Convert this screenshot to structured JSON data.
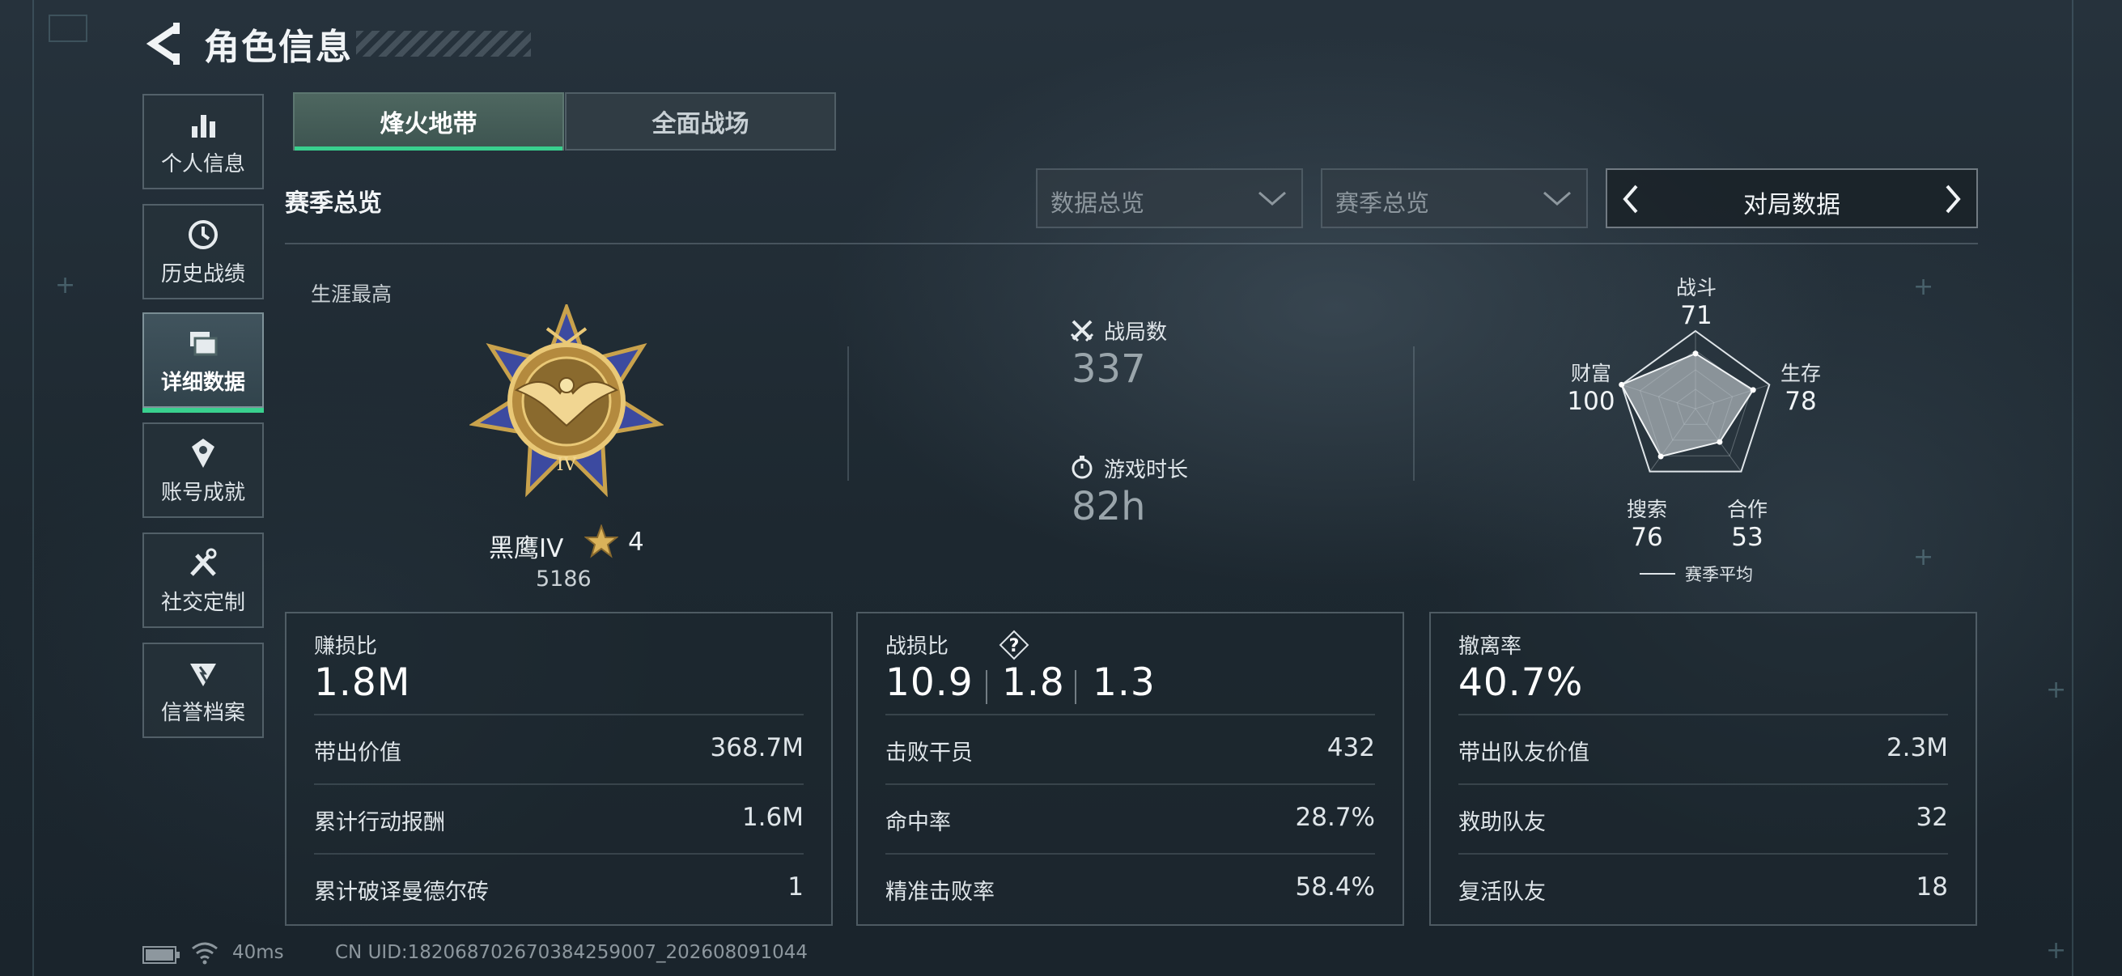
{
  "header": {
    "title": "角色信息",
    "back_icon": "back-arrow-icon"
  },
  "nav": [
    {
      "label": "个人信息",
      "icon": "bar-chart-icon"
    },
    {
      "label": "历史战绩",
      "icon": "clock-icon"
    },
    {
      "label": "详细数据",
      "icon": "stack-cards-icon",
      "active": true
    },
    {
      "label": "账号成就",
      "icon": "medal-icon"
    },
    {
      "label": "社交定制",
      "icon": "tools-icon"
    },
    {
      "label": "信誉档案",
      "icon": "shield-badge-icon"
    }
  ],
  "tabs": [
    {
      "label": "烽火地带",
      "active": true
    },
    {
      "label": "全面战场",
      "active": false
    }
  ],
  "section_title": "赛季总览",
  "dropdowns": {
    "data_overview": "数据总览",
    "season_overview": "赛季总览"
  },
  "pager": {
    "label": "对局数据"
  },
  "career": {
    "label": "生涯最高",
    "rank_name": "黑鹰IV",
    "stars": "4",
    "score": "5186",
    "medal_numeral": "IV"
  },
  "stats": {
    "matches_label": "战局数",
    "matches_value": "337",
    "playtime_label": "游戏时长",
    "playtime_value": "82h"
  },
  "radar": {
    "axes": [
      {
        "label": "战斗",
        "value": "71"
      },
      {
        "label": "生存",
        "value": "78"
      },
      {
        "label": "合作",
        "value": "53"
      },
      {
        "label": "搜索",
        "value": "76"
      },
      {
        "label": "财富",
        "value": "100"
      }
    ],
    "legend": "赛季平均"
  },
  "cards": {
    "profit": {
      "title": "赚损比",
      "big": "1.8M",
      "rows": [
        {
          "label": "带出价值",
          "value": "368.7M"
        },
        {
          "label": "累计行动报酬",
          "value": "1.6M"
        },
        {
          "label": "累计破译曼德尔砖",
          "value": "1"
        }
      ]
    },
    "kd": {
      "title": "战损比",
      "help": "?",
      "values": [
        "10.9",
        "1.8",
        "1.3"
      ],
      "rows": [
        {
          "label": "击败干员",
          "value": "432"
        },
        {
          "label": "命中率",
          "value": "28.7%"
        },
        {
          "label": "精准击败率",
          "value": "58.4%"
        }
      ]
    },
    "extract": {
      "title": "撤离率",
      "big": "40.7%",
      "rows": [
        {
          "label": "带出队友价值",
          "value": "2.3M"
        },
        {
          "label": "救助队友",
          "value": "32"
        },
        {
          "label": "复活队友",
          "value": "18"
        }
      ]
    }
  },
  "status": {
    "ping": "40ms",
    "uid": "CN UID:182068702670384259007_202608091044"
  }
}
